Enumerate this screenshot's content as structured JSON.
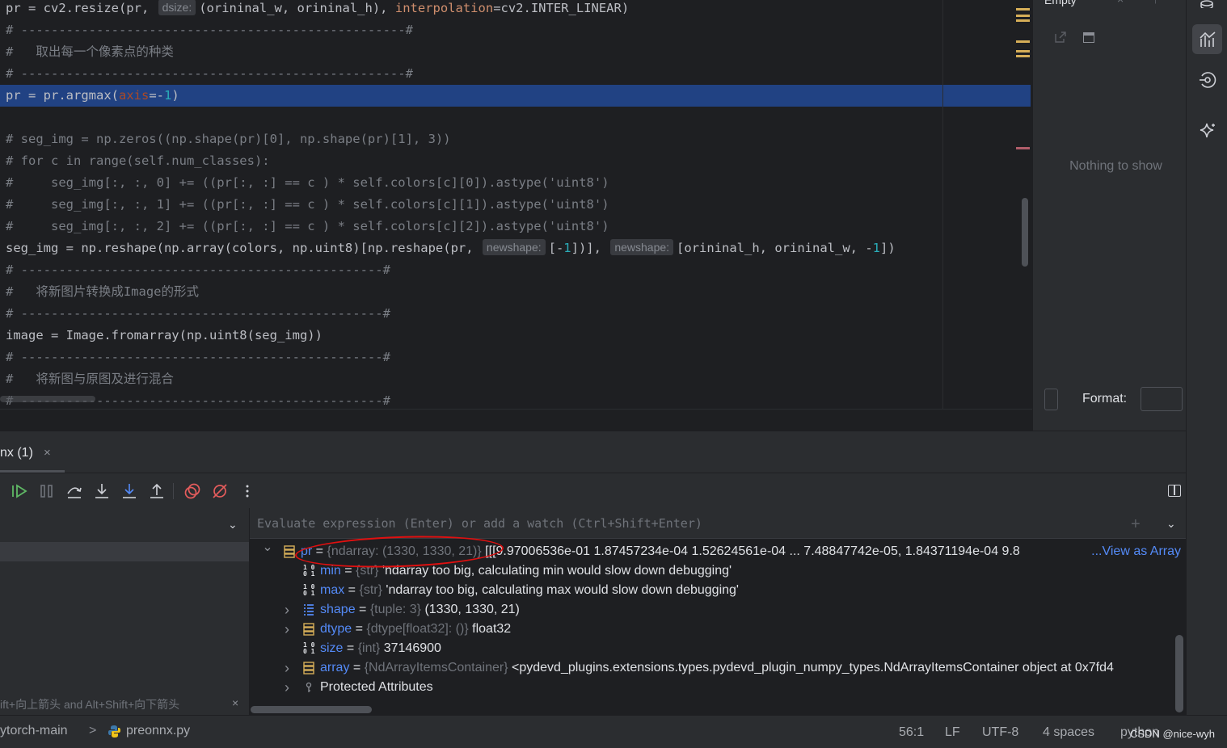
{
  "editor": {
    "lines": [
      {
        "segments": [
          [
            "def",
            "pr = cv2.resize(pr, "
          ],
          [
            "hint",
            "dsize:"
          ],
          [
            "def",
            "(orininal_w, orininal_h), "
          ],
          [
            "kw",
            "interpolation"
          ],
          [
            "def",
            "=cv2.INTER_LINEAR)"
          ]
        ]
      },
      {
        "segments": [
          [
            "com",
            "# ---------------------------------------------------#"
          ]
        ]
      },
      {
        "segments": [
          [
            "com",
            "#   取出每一个像素点的种类"
          ]
        ]
      },
      {
        "segments": [
          [
            "com",
            "# ---------------------------------------------------#"
          ]
        ]
      },
      {
        "current": true,
        "segments": [
          [
            "def",
            "pr = pr.argmax("
          ],
          [
            "par",
            "axis"
          ],
          [
            "def",
            "=-"
          ],
          [
            "num",
            "1"
          ],
          [
            "def",
            ")"
          ]
        ]
      },
      {
        "segments": []
      },
      {
        "segments": [
          [
            "com",
            "# seg_img = np.zeros((np.shape(pr)[0], np.shape(pr)[1], 3))"
          ]
        ]
      },
      {
        "segments": [
          [
            "com",
            "# for c in range(self.num_classes):"
          ]
        ]
      },
      {
        "segments": [
          [
            "com",
            "#     seg_img[:, :, 0] += ((pr[:, :] == c ) * self.colors[c][0]).astype('uint8')"
          ]
        ]
      },
      {
        "segments": [
          [
            "com",
            "#     seg_img[:, :, 1] += ((pr[:, :] == c ) * self.colors[c][1]).astype('uint8')"
          ]
        ]
      },
      {
        "segments": [
          [
            "com",
            "#     seg_img[:, :, 2] += ((pr[:, :] == c ) * self.colors[c][2]).astype('uint8')"
          ]
        ]
      },
      {
        "segments": [
          [
            "def",
            "seg_img = np.reshape(np.array(colors, np.uint8)[np.reshape(pr, "
          ],
          [
            "hint",
            "newshape:"
          ],
          [
            "def",
            "[-"
          ],
          [
            "num",
            "1"
          ],
          [
            "def",
            "])], "
          ],
          [
            "hint",
            "newshape:"
          ],
          [
            "def",
            "[orininal_h, orininal_w, -"
          ],
          [
            "num",
            "1"
          ],
          [
            "def",
            "])"
          ]
        ]
      },
      {
        "segments": [
          [
            "com",
            "# ------------------------------------------------#"
          ]
        ]
      },
      {
        "segments": [
          [
            "com",
            "#   将新图片转换成Image的形式"
          ]
        ]
      },
      {
        "segments": [
          [
            "com",
            "# ------------------------------------------------#"
          ]
        ]
      },
      {
        "segments": [
          [
            "def",
            "image = Image.fromarray(np.uint8(seg_img))"
          ]
        ]
      },
      {
        "segments": [
          [
            "com",
            "# ------------------------------------------------#"
          ]
        ]
      },
      {
        "segments": [
          [
            "com",
            "#   将新图与原图及进行混合"
          ]
        ]
      },
      {
        "segments": [
          [
            "com",
            "# ------------------------------------------------#"
          ]
        ]
      }
    ]
  },
  "right_panel": {
    "title": "Empty",
    "empty_text": "Nothing to show",
    "format_label": "Format:"
  },
  "debug": {
    "tab_label": "nx (1)",
    "tab_close": "×",
    "watch_placeholder": "Evaluate expression (Enter) or add a watch (Ctrl+Shift+Enter)",
    "frames_hint": "ift+向上箭头 and Alt+Shift+向下箭头",
    "frames_hint_close": "×",
    "variables": [
      {
        "expand": "v",
        "icon": "array",
        "name": "pr",
        "type": "{ndarray: (1330, 1330, 21)}",
        "value": "[[[9.97006536e-01 1.87457234e-04 1.52624561e-04 ... 7.48847742e-05,   1.84371194e-04 9.8",
        "link": "...View as Array"
      },
      {
        "expand": "",
        "icon": "bin",
        "name": "min",
        "type": "{str}",
        "value": "'ndarray too big, calculating min would slow down debugging'",
        "link": ""
      },
      {
        "expand": "",
        "icon": "bin",
        "name": "max",
        "type": "{str}",
        "value": "'ndarray too big, calculating max would slow down debugging'",
        "link": ""
      },
      {
        "expand": ">",
        "icon": "list",
        "name": "shape",
        "type": "{tuple: 3}",
        "value": "(1330, 1330, 21)",
        "link": ""
      },
      {
        "expand": ">",
        "icon": "array",
        "name": "dtype",
        "type": "{dtype[float32]: ()}",
        "value": "float32",
        "link": ""
      },
      {
        "expand": "",
        "icon": "bin",
        "name": "size",
        "type": "{int}",
        "value": "37146900",
        "link": ""
      },
      {
        "expand": ">",
        "icon": "array",
        "name": "array",
        "type": "{NdArrayItemsContainer}",
        "value": "<pydevd_plugins.extensions.types.pydevd_plugin_numpy_types.NdArrayItemsContainer object at 0x7fd4",
        "link": ""
      },
      {
        "expand": ">",
        "icon": "key",
        "name": "Protected Attributes",
        "type": "",
        "value": "",
        "link": ""
      }
    ]
  },
  "status_bar": {
    "project": "ytorch-main",
    "separator": ">",
    "file": "preonnx.py",
    "position": "56:1",
    "line_ending": "LF",
    "encoding": "UTF-8",
    "indent": "4 spaces",
    "interpreter": "python",
    "watermark": "CSDN @nice-wyh"
  },
  "colors": {
    "current_line": "#214283",
    "var_name": "#548af7",
    "annotation": "#e01010",
    "breakpoint": "#e55c5c"
  }
}
